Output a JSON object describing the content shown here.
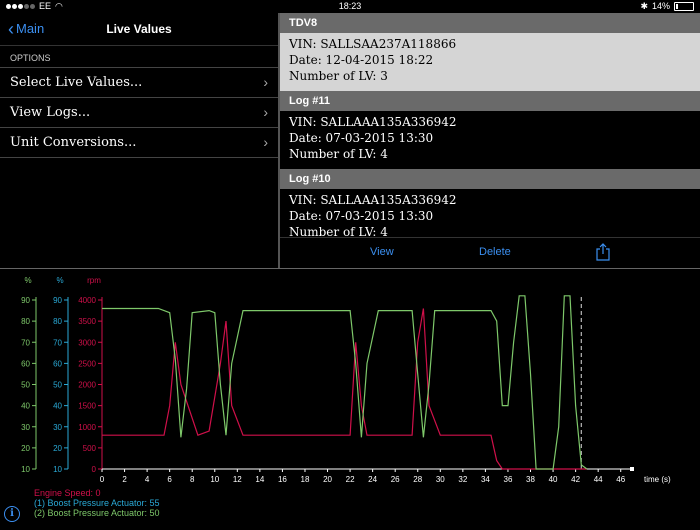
{
  "status": {
    "carrier": "EE",
    "time": "18:23",
    "battery": "14%",
    "battery_level": 0.14
  },
  "nav": {
    "back_label": "Main",
    "title": "Live Values"
  },
  "options": {
    "section_label": "OPTIONS",
    "items": [
      {
        "label": "Select Live Values..."
      },
      {
        "label": "View Logs..."
      },
      {
        "label": "Unit Conversions..."
      }
    ]
  },
  "logs": [
    {
      "header": "TDV8",
      "vin": "VIN: SALLSAA237A118866",
      "date": "Date: 12-04-2015 18:22",
      "count": "Number of LV: 3",
      "selected": true
    },
    {
      "header": "Log #11",
      "vin": "VIN: SALLAAA135A336942",
      "date": "Date: 07-03-2015 13:30",
      "count": "Number of LV: 4"
    },
    {
      "header": "Log #10",
      "vin": "VIN: SALLAAA135A336942",
      "date": "Date: 07-03-2015 13:30",
      "count": "Number of LV: 4"
    }
  ],
  "actions": {
    "view": "View",
    "delete": "Delete"
  },
  "colors": {
    "accent": "#3b8ff0",
    "engine": "#d0104a",
    "boost1": "#2aa9d6",
    "boost2": "#7ec86a"
  },
  "chart_data": {
    "type": "line",
    "xlabel": "time (s)",
    "xlim": [
      0,
      47
    ],
    "x_ticks": [
      0,
      2,
      4,
      6,
      8,
      10,
      12,
      14,
      16,
      18,
      20,
      22,
      24,
      26,
      28,
      30,
      32,
      34,
      36,
      38,
      40,
      42,
      44,
      46
    ],
    "cursor_x": 42.5,
    "axes": [
      {
        "unit": "%",
        "color": "#7ec86a",
        "ylim": [
          10,
          90
        ],
        "ticks": [
          10,
          20,
          30,
          40,
          50,
          60,
          70,
          80,
          90
        ]
      },
      {
        "unit": "%",
        "color": "#2aa9d6",
        "ylim": [
          10,
          90
        ],
        "ticks": [
          10,
          20,
          30,
          40,
          50,
          60,
          70,
          80,
          90
        ]
      },
      {
        "unit": "rpm",
        "color": "#d0104a",
        "ylim": [
          0,
          4000
        ],
        "ticks": [
          0,
          500,
          1000,
          1500,
          2000,
          2500,
          3000,
          3500,
          4000
        ]
      }
    ],
    "series": [
      {
        "name": "Engine Speed",
        "color": "#d0104a",
        "axis": 2,
        "x": [
          0,
          5.5,
          6,
          6.5,
          7,
          8.5,
          9.5,
          10.5,
          11,
          11.5,
          12.5,
          22,
          22.5,
          23,
          23.5,
          24.5,
          27.5,
          28,
          28.5,
          29,
          30,
          34.5,
          35,
          35.5,
          43
        ],
        "y": [
          800,
          800,
          1500,
          3000,
          2000,
          800,
          900,
          2500,
          3500,
          1500,
          800,
          800,
          3000,
          1500,
          800,
          800,
          800,
          3000,
          3800,
          1500,
          800,
          800,
          200,
          0,
          0
        ]
      },
      {
        "name": "Boost Pressure Actuator",
        "color": "#7ec86a",
        "axis": 0,
        "x": [
          0,
          5,
          6,
          6.5,
          7,
          7.5,
          8,
          9.5,
          10,
          10.5,
          11,
          11.5,
          12.5,
          22,
          22.5,
          23,
          23.5,
          24.5,
          27.5,
          28,
          28.5,
          29,
          29.5,
          34.5,
          35,
          35.5,
          36,
          36.5,
          37,
          37.5,
          38,
          38.5,
          39,
          39.5,
          40,
          40.5,
          41,
          41.5,
          42,
          42.5,
          43
        ],
        "y": [
          86,
          86,
          84,
          62,
          25,
          48,
          84,
          85,
          84,
          50,
          26,
          60,
          85,
          85,
          60,
          25,
          60,
          85,
          85,
          55,
          25,
          50,
          85,
          85,
          80,
          40,
          40,
          70,
          92,
          92,
          55,
          10,
          10,
          10,
          10,
          30,
          92,
          92,
          40,
          12,
          10
        ]
      }
    ],
    "legend": [
      {
        "label": "Engine Speed: 0",
        "color": "#d0104a"
      },
      {
        "label": "(1) Boost Pressure Actuator: 55",
        "color": "#2aa9d6"
      },
      {
        "label": "(2) Boost Pressure Actuator: 50",
        "color": "#7ec86a"
      }
    ]
  }
}
